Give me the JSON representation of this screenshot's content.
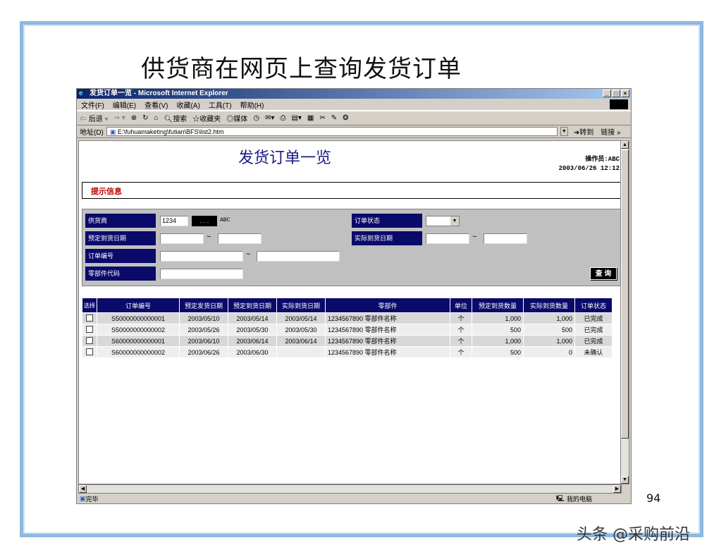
{
  "slide": {
    "title": "供货商在网页上查询发货订单",
    "page_number": "94",
    "watermark": "头条 @采购前沿"
  },
  "window": {
    "title": "发货订单一览 - Microsoft Internet Explorer",
    "menu": [
      "文件(F)",
      "编辑(E)",
      "查看(V)",
      "收藏(A)",
      "工具(T)",
      "帮助(H)"
    ],
    "toolbar": {
      "back": "后退",
      "search": "搜索",
      "favorites": "收藏夹",
      "media": "媒体"
    },
    "address_label": "地址(D)",
    "address": "E:\\fuhuamaketing\\futian\\BFS\\list2.htm",
    "go_label": "转到",
    "links_label": "链接 »",
    "status_text": "完毕",
    "status_zone": "我的电脑"
  },
  "page": {
    "heading": "发货订单一览",
    "operator_label": "操作员:ABC",
    "datetime": "2003/06/26 12:12",
    "hint_label": "提示信息",
    "search": {
      "supplier_label": "供货商",
      "supplier_value": "1234",
      "ellipsis": ". . .",
      "supplier_name": "ABC",
      "order_status_label": "订单状态",
      "planned_date_label": "预定到货日期",
      "actual_date_label": "实际到货日期",
      "order_no_label": "订单编号",
      "part_code_label": "零部件代码",
      "tilde": "~",
      "query_button": "查 询"
    },
    "table": {
      "headers": [
        "选择",
        "订单编号",
        "预定发货日期",
        "预定到货日期",
        "实际到货日期",
        "零部件",
        "单位",
        "预定到货数量",
        "实际到货数量",
        "订单状态"
      ],
      "rows": [
        {
          "order_no": "S50000000000001",
          "ship_date": "2003/05/10",
          "planned": "2003/05/14",
          "actual": "2003/05/14",
          "part": "1234567890 零部件名称",
          "unit": "个",
          "planned_qty": "1,000",
          "actual_qty": "1,000",
          "status": "已完成"
        },
        {
          "order_no": "S50000000000002",
          "ship_date": "2003/05/26",
          "planned": "2003/05/30",
          "actual": "2003/05/30",
          "part": "1234567890 零部件名称",
          "unit": "个",
          "planned_qty": "500",
          "actual_qty": "500",
          "status": "已完成"
        },
        {
          "order_no": "S60000000000001",
          "ship_date": "2003/06/10",
          "planned": "2003/06/14",
          "actual": "2003/06/14",
          "part": "1234567890 零部件名称",
          "unit": "个",
          "planned_qty": "1,000",
          "actual_qty": "1,000",
          "status": "已完成"
        },
        {
          "order_no": "S60000000000002",
          "ship_date": "2003/06/26",
          "planned": "2003/06/30",
          "actual": "",
          "part": "1234567890 零部件名称",
          "unit": "个",
          "planned_qty": "500",
          "actual_qty": "0",
          "status": "未确认"
        }
      ]
    }
  }
}
